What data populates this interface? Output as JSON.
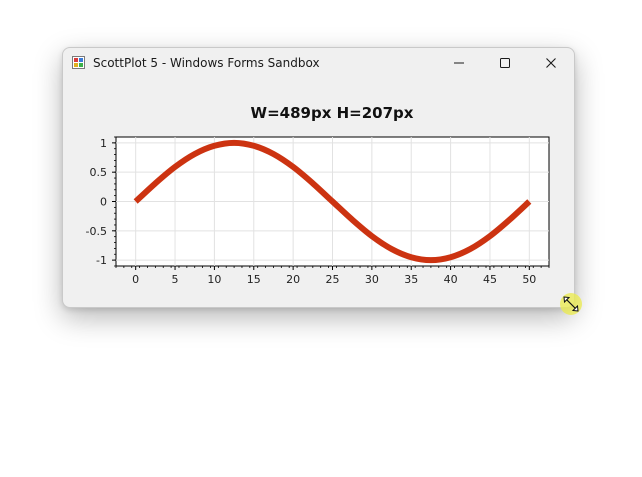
{
  "window": {
    "title": "ScottPlot 5 - Windows Forms Sandbox",
    "app_icon": "scottplot-app-icon",
    "controls": {
      "minimize_icon": "minimize-icon",
      "maximize_icon": "maximize-icon",
      "close_icon": "close-icon"
    }
  },
  "cursor": {
    "icon": "resize-diagonal-icon"
  },
  "colors": {
    "series": "#cc3311",
    "window_bg": "#f0f0f0",
    "plot_bg": "#ffffff",
    "grid": "#e2e2e2",
    "cursor_highlight": "#ebeb50"
  },
  "chart_data": {
    "type": "line",
    "title": "W=489px H=207px",
    "xlabel": "",
    "ylabel": "",
    "xlim": [
      -2.5,
      52.5
    ],
    "ylim": [
      -1.1,
      1.1
    ],
    "x_ticks": [
      0,
      5,
      10,
      15,
      20,
      25,
      30,
      35,
      40,
      45,
      50
    ],
    "x_tick_labels": [
      "0",
      "5",
      "10",
      "15",
      "20",
      "25",
      "30",
      "35",
      "40",
      "45",
      "50"
    ],
    "y_ticks": [
      1,
      0.5,
      0,
      -0.5,
      -1
    ],
    "y_tick_labels": [
      "1",
      "0.5",
      "0",
      "-0.5",
      "-1"
    ],
    "grid": true,
    "series": [
      {
        "x": [
          0,
          2.5,
          5,
          7.5,
          10,
          12.5,
          15,
          17.5,
          20,
          22.5,
          25,
          27.5,
          30,
          32.5,
          35,
          37.5,
          40,
          42.5,
          45,
          47.5,
          50
        ],
        "y": [
          0,
          0.31,
          0.59,
          0.81,
          0.95,
          1,
          0.95,
          0.81,
          0.59,
          0.31,
          0,
          -0.31,
          -0.59,
          -0.81,
          -0.95,
          -1,
          -0.95,
          -0.81,
          -0.59,
          -0.31,
          0
        ]
      }
    ]
  }
}
